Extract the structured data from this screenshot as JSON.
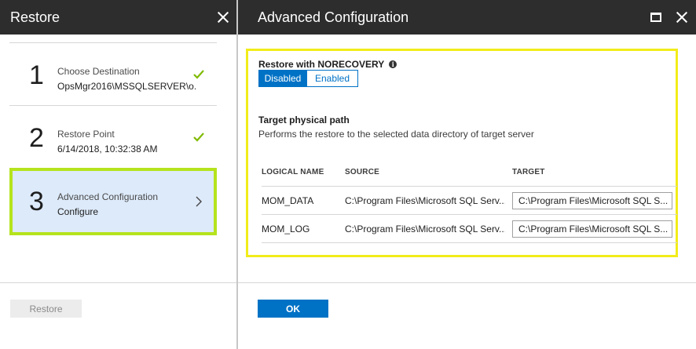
{
  "restore_blade": {
    "title": "Restore",
    "steps": [
      {
        "number": "1",
        "title": "Choose Destination",
        "value": "OpsMgr2016\\MSSQLSERVER\\o...",
        "status": "complete"
      },
      {
        "number": "2",
        "title": "Restore Point",
        "value": "6/14/2018, 10:32:38 AM",
        "status": "complete"
      },
      {
        "number": "3",
        "title": "Advanced Configuration",
        "value": "Configure",
        "status": "active"
      }
    ],
    "restore_button": "Restore"
  },
  "advanced_blade": {
    "title": "Advanced Configuration",
    "norecovery": {
      "label": "Restore with NORECOVERY",
      "options": [
        "Disabled",
        "Enabled"
      ],
      "selected": "Disabled"
    },
    "target_path": {
      "title": "Target physical path",
      "description": "Performs the restore to the selected data directory of target server"
    },
    "table": {
      "headers": [
        "LOGICAL NAME",
        "SOURCE",
        "TARGET"
      ],
      "rows": [
        {
          "logical_name": "MOM_DATA",
          "source": "C:\\Program Files\\Microsoft SQL Serv...",
          "target": "C:\\Program Files\\Microsoft SQL S..."
        },
        {
          "logical_name": "MOM_LOG",
          "source": "C:\\Program Files\\Microsoft SQL Serv...",
          "target": "C:\\Program Files\\Microsoft SQL S..."
        }
      ]
    },
    "ok_button": "OK"
  },
  "colors": {
    "header_bg": "#2d2d2d",
    "accent_blue": "#0072c6",
    "check_green": "#7fba00",
    "active_border": "#b5e31d",
    "highlight_border": "#f2ec1a",
    "active_bg": "#ddeafa"
  },
  "icons": [
    "close-icon",
    "checkmark-icon",
    "chevron-right-icon",
    "maximize-icon",
    "info-icon"
  ]
}
